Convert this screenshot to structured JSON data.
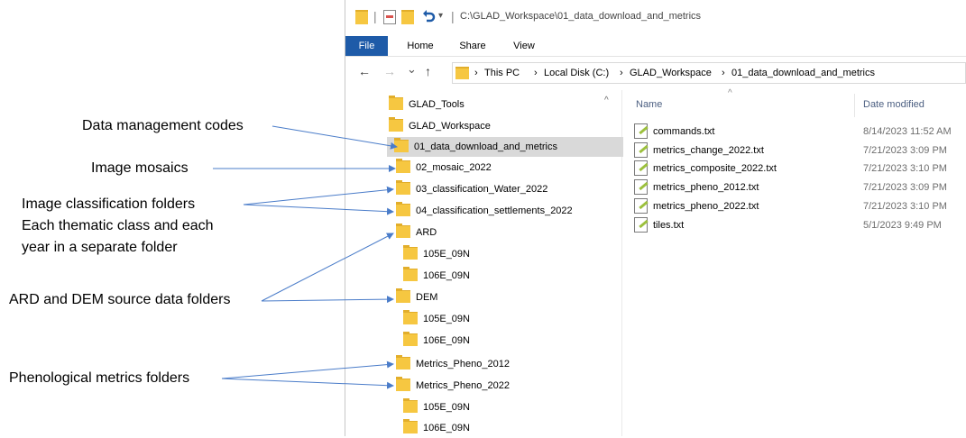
{
  "annotations": {
    "data_management": "Data management codes",
    "image_mosaics": "Image mosaics",
    "classification_1": "Image classification folders",
    "classification_2": "Each thematic class and each",
    "classification_3": "year in a separate folder",
    "ard_dem": "ARD and DEM source data folders",
    "phenological": "Phenological metrics folders"
  },
  "window": {
    "title_path": "C:\\GLAD_Workspace\\01_data_download_and_metrics",
    "title_separator": "|",
    "qa_dropdown": "▾"
  },
  "ribbon": {
    "tabs": [
      "File",
      "Home",
      "Share",
      "View"
    ]
  },
  "address": {
    "back": "←",
    "forward": "→",
    "recent": "⌄",
    "up": "↑",
    "sep": "›",
    "crumbs": [
      "This PC",
      "Local Disk (C:)",
      "GLAD_Workspace",
      "01_data_download_and_metrics"
    ]
  },
  "nav_tree": {
    "items": [
      "GLAD_Tools",
      "GLAD_Workspace",
      "01_data_download_and_metrics",
      "02_mosaic_2022",
      "03_classification_Water_2022",
      "04_classification_settlements_2022",
      "ARD",
      "105E_09N",
      "106E_09N",
      "DEM",
      "105E_09N",
      "106E_09N",
      "Metrics_Pheno_2012",
      "Metrics_Pheno_2022",
      "105E_09N",
      "106E_09N"
    ],
    "scroll_up": "^"
  },
  "file_list": {
    "columns": {
      "name": "Name",
      "date_modified": "Date modified",
      "sort_indicator": "^"
    },
    "files": [
      {
        "name": "commands.txt",
        "date": "8/14/2023 11:52 AM"
      },
      {
        "name": "metrics_change_2022.txt",
        "date": "7/21/2023 3:09 PM"
      },
      {
        "name": "metrics_composite_2022.txt",
        "date": "7/21/2023 3:10 PM"
      },
      {
        "name": "metrics_pheno_2012.txt",
        "date": "7/21/2023 3:09 PM"
      },
      {
        "name": "metrics_pheno_2022.txt",
        "date": "7/21/2023 3:10 PM"
      },
      {
        "name": "tiles.txt",
        "date": "5/1/2023 9:49 PM"
      }
    ]
  },
  "colors": {
    "file_tab": "#1e5ba8",
    "selected_row": "#d9d9d9",
    "folder": "#f6c741",
    "arrow": "#4a7cc9"
  }
}
